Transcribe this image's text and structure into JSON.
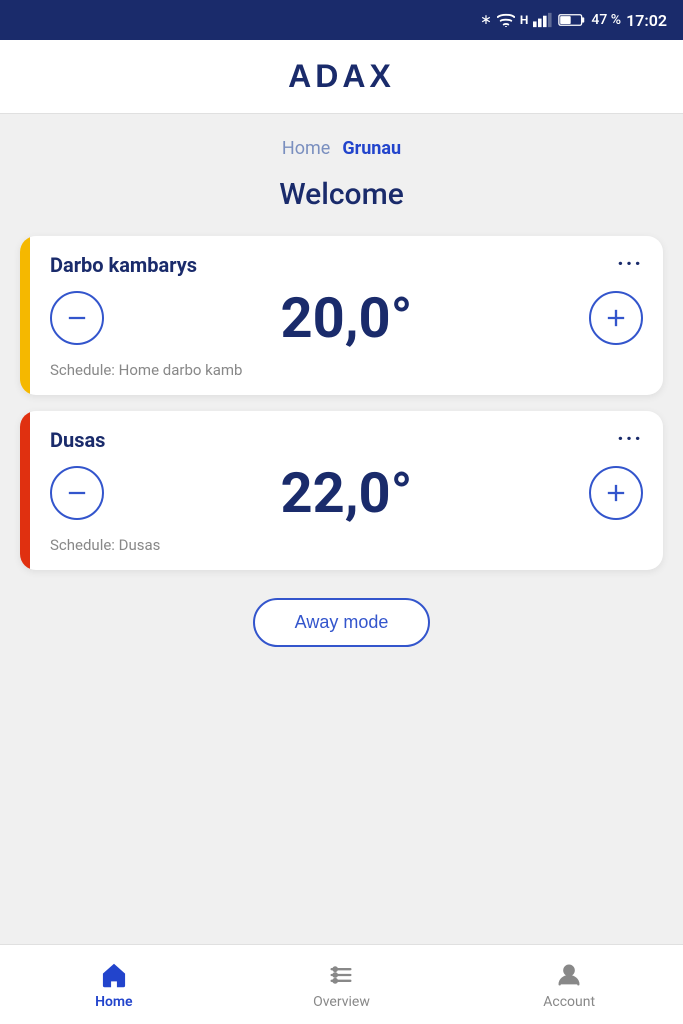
{
  "statusBar": {
    "battery": "47 %",
    "time": "17:02"
  },
  "header": {
    "logo": "ADAX"
  },
  "breadcrumb": {
    "home": "Home",
    "active": "Grunau"
  },
  "welcome": "Welcome",
  "cards": [
    {
      "id": "darbo",
      "accent": "yellow",
      "title": "Darbo kambarys",
      "temperature": "20,0°",
      "schedule": "Schedule: Home darbo kamb"
    },
    {
      "id": "dusas",
      "accent": "red",
      "title": "Dusas",
      "temperature": "22,0°",
      "schedule": "Schedule: Dusas"
    }
  ],
  "awayMode": {
    "label": "Away mode"
  },
  "bottomNav": [
    {
      "id": "home",
      "label": "Home",
      "active": true
    },
    {
      "id": "overview",
      "label": "Overview",
      "active": false
    },
    {
      "id": "account",
      "label": "Account",
      "active": false
    }
  ]
}
